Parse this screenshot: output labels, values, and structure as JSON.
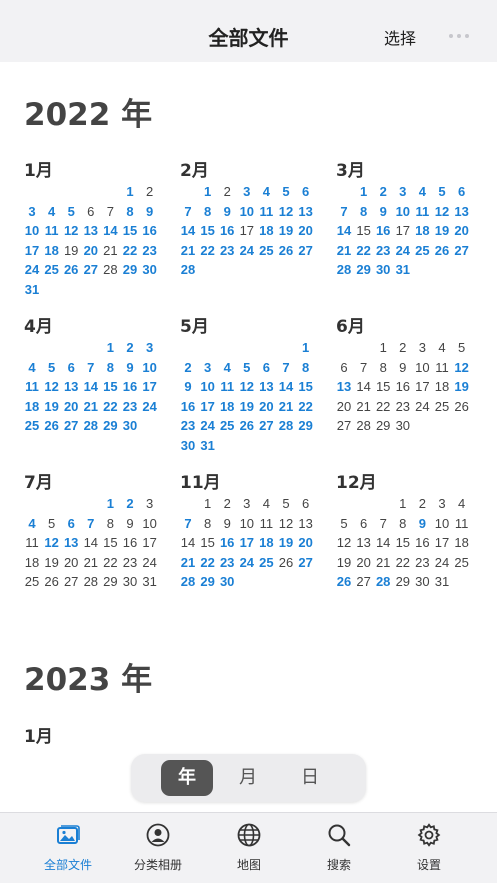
{
  "header": {
    "title": "全部文件",
    "select_label": "选择",
    "more_icon": "ellipsis-icon"
  },
  "years": [
    {
      "label": "2022 年",
      "months": [
        {
          "label": "1月",
          "offset": 5,
          "days": 31,
          "highlighted": [
            1,
            3,
            4,
            5,
            8,
            9,
            10,
            11,
            12,
            13,
            14,
            15,
            16,
            17,
            18,
            20,
            22,
            23,
            24,
            25,
            26,
            27,
            29,
            30,
            31
          ]
        },
        {
          "label": "2月",
          "offset": 1,
          "days": 28,
          "highlighted": [
            1,
            3,
            4,
            5,
            6,
            7,
            8,
            9,
            10,
            11,
            12,
            13,
            14,
            15,
            16,
            18,
            19,
            20,
            21,
            22,
            23,
            24,
            25,
            26,
            27,
            28
          ]
        },
        {
          "label": "3月",
          "offset": 1,
          "days": 31,
          "highlighted": [
            1,
            2,
            3,
            4,
            5,
            6,
            7,
            8,
            9,
            10,
            11,
            12,
            13,
            14,
            16,
            18,
            19,
            20,
            21,
            22,
            23,
            24,
            25,
            26,
            27,
            28,
            29,
            30,
            31
          ]
        },
        {
          "label": "4月",
          "offset": 4,
          "days": 30,
          "highlighted": [
            1,
            2,
            3,
            4,
            5,
            6,
            7,
            8,
            9,
            10,
            11,
            12,
            13,
            14,
            15,
            16,
            17,
            18,
            19,
            20,
            21,
            22,
            23,
            24,
            25,
            26,
            27,
            28,
            29,
            30
          ]
        },
        {
          "label": "5月",
          "offset": 6,
          "days": 31,
          "highlighted": [
            1,
            2,
            3,
            4,
            5,
            6,
            7,
            8,
            9,
            10,
            11,
            12,
            13,
            14,
            15,
            16,
            17,
            18,
            19,
            20,
            21,
            22,
            23,
            24,
            25,
            26,
            27,
            28,
            29,
            30,
            31
          ]
        },
        {
          "label": "6月",
          "offset": 2,
          "days": 30,
          "highlighted": [
            12,
            13,
            19
          ]
        },
        {
          "label": "7月",
          "offset": 4,
          "days": 31,
          "highlighted": [
            1,
            2,
            4,
            6,
            7,
            12,
            13
          ]
        },
        {
          "label": "11月",
          "offset": 1,
          "days": 30,
          "highlighted": [
            7,
            16,
            17,
            18,
            19,
            20,
            21,
            22,
            23,
            24,
            25,
            27,
            28,
            29,
            30
          ]
        },
        {
          "label": "12月",
          "offset": 3,
          "days": 31,
          "highlighted": [
            9,
            26,
            28
          ]
        }
      ]
    },
    {
      "label": "2023 年",
      "months": [
        {
          "label": "1月",
          "offset": 0,
          "days": 0,
          "highlighted": []
        }
      ]
    }
  ],
  "segment": {
    "items": [
      "年",
      "月",
      "日"
    ],
    "selected": "年"
  },
  "tabs": [
    {
      "label": "全部文件",
      "icon": "photos-icon",
      "active": true
    },
    {
      "label": "分类相册",
      "icon": "person-circle-icon",
      "active": false
    },
    {
      "label": "地图",
      "icon": "globe-icon",
      "active": false
    },
    {
      "label": "搜索",
      "icon": "search-icon",
      "active": false
    },
    {
      "label": "设置",
      "icon": "gear-icon",
      "active": false
    }
  ],
  "colors": {
    "accent": "#1a7fd4",
    "day_text": "#444444",
    "segment_active": "#555555"
  }
}
